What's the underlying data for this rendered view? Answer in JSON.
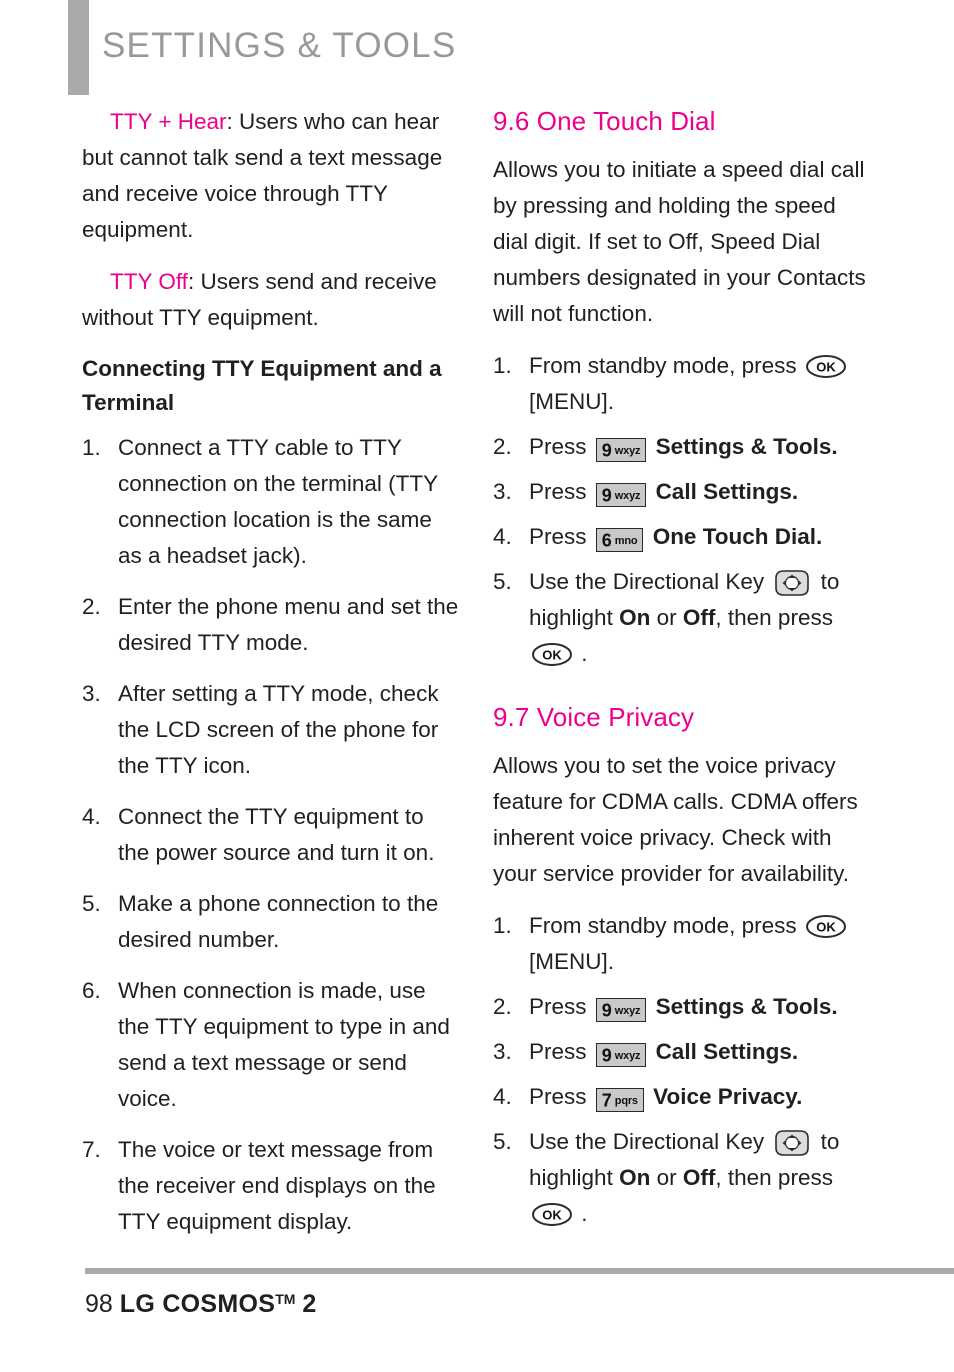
{
  "header": {
    "title": "SETTINGS & TOOLS",
    "accent_bar_color": "#aaaaaa",
    "title_color": "#999999"
  },
  "colors": {
    "accent_pink": "#ec008c",
    "body_text": "#231f20",
    "key_fill": "#c9c9c9",
    "rule_gray": "#aaaaaa"
  },
  "left_column": {
    "paragraphs": [
      {
        "label": "TTY + Hear",
        "text": ": Users who can hear but cannot talk send a text message and receive voice through TTY equipment."
      },
      {
        "label": "TTY Off",
        "text": ": Users send and receive without TTY equipment."
      }
    ],
    "heading": "Connecting TTY Equipment and a Terminal",
    "steps": [
      {
        "num": "1.",
        "text": "Connect a TTY cable to TTY connection on the terminal (TTY connection location is the same as a headset jack)."
      },
      {
        "num": "2.",
        "text": "Enter the phone menu and set the desired TTY mode."
      },
      {
        "num": "3.",
        "text": "After setting a TTY mode, check the LCD screen of the phone for the TTY icon."
      },
      {
        "num": "4.",
        "text": "Connect the TTY equipment to the power source and turn it on."
      },
      {
        "num": "5.",
        "text": "Make a phone connection to the desired number."
      },
      {
        "num": "6.",
        "text": "When connection is made, use the TTY equipment to type in and send a text message or send voice."
      },
      {
        "num": "7.",
        "text": "The voice or text message from the receiver end displays on the TTY equipment display."
      }
    ]
  },
  "right_column": {
    "section_one_touch_dial": {
      "heading": "9.6 One Touch Dial",
      "intro": "Allows you to initiate a speed dial call by pressing and holding the speed dial digit. If set to Off, Speed Dial numbers designated in your Contacts will not function.",
      "steps": [
        {
          "num": "1.",
          "pre": "From standby mode, press",
          "key": {
            "type": "ok",
            "label": "OK"
          },
          "post": "[MENU]."
        },
        {
          "num": "2.",
          "pre": "Press",
          "key": {
            "type": "digit",
            "digit": "9",
            "letters": "wxyz"
          },
          "post": "Settings & Tools.",
          "post_bold": true
        },
        {
          "num": "3.",
          "pre": "Press",
          "key": {
            "type": "digit",
            "digit": "9",
            "letters": "wxyz"
          },
          "post": "Call Settings.",
          "post_bold": true
        },
        {
          "num": "4.",
          "pre": "Press",
          "key": {
            "type": "digit",
            "digit": "6",
            "letters": "mno"
          },
          "post": "One Touch Dial.",
          "post_bold": true
        },
        {
          "num": "5.",
          "pre": "Use the Directional Key",
          "key": {
            "type": "dpad",
            "label": "Directional Key"
          },
          "mid": "to highlight",
          "opt_on": "On",
          "or": "or",
          "opt_off": "Off",
          "post": ", then press",
          "key2": {
            "type": "ok",
            "label": "OK"
          },
          "end": "."
        }
      ]
    },
    "section_voice_privacy": {
      "heading": "9.7 Voice Privacy",
      "intro": "Allows you to set the voice privacy feature for CDMA calls. CDMA offers inherent voice privacy. Check with your service provider for availability.",
      "steps": [
        {
          "num": "1.",
          "pre": "From standby mode, press",
          "key": {
            "type": "ok",
            "label": "OK"
          },
          "post": "[MENU]."
        },
        {
          "num": "2.",
          "pre": "Press",
          "key": {
            "type": "digit",
            "digit": "9",
            "letters": "wxyz"
          },
          "post": "Settings & Tools.",
          "post_bold": true
        },
        {
          "num": "3.",
          "pre": "Press",
          "key": {
            "type": "digit",
            "digit": "9",
            "letters": "wxyz"
          },
          "post": "Call Settings.",
          "post_bold": true
        },
        {
          "num": "4.",
          "pre": "Press",
          "key": {
            "type": "digit",
            "digit": "7",
            "letters": "pqrs"
          },
          "post": "Voice Privacy.",
          "post_bold": true
        },
        {
          "num": "5.",
          "pre": "Use the Directional Key",
          "key": {
            "type": "dpad",
            "label": "Directional Key"
          },
          "mid": "to highlight",
          "opt_on": "On",
          "or": "or",
          "opt_off": "Off",
          "post": ", then press",
          "key2": {
            "type": "ok",
            "label": "OK"
          },
          "end": "."
        }
      ]
    }
  },
  "footer": {
    "page_number": "98",
    "brand": "LG COSMOS",
    "trademark": "TM",
    "model": "2"
  }
}
